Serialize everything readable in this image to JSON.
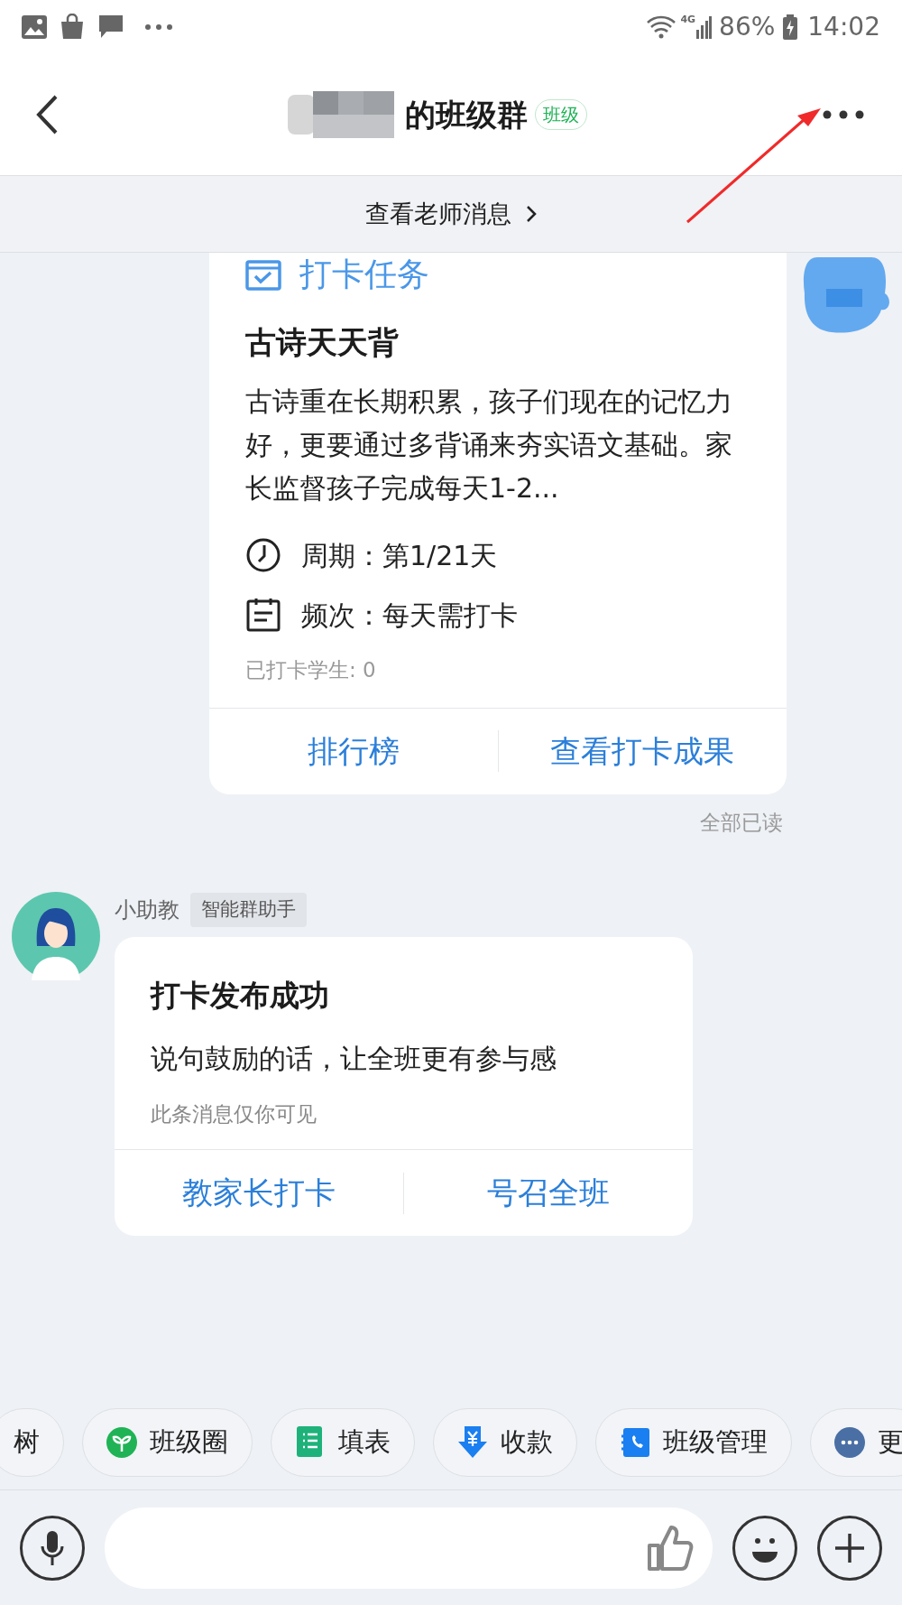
{
  "status_bar": {
    "network": "4G",
    "battery": "86%",
    "time": "14:02"
  },
  "header": {
    "title": "的班级群",
    "tag": "班级"
  },
  "notice": "查看老师消息",
  "messages": [
    {
      "kind": "task_card",
      "card_label": "打卡任务",
      "title": "古诗天天背",
      "description": "古诗重在长期积累，孩子们现在的记忆力好，更要通过多背诵来夯实语文基础。家长监督孩子完成每天1-2...",
      "period": "周期：第1/21天",
      "frequency": "频次：每天需打卡",
      "checked_in": "已打卡学生: 0",
      "actions": [
        "排行榜",
        "查看打卡成果"
      ],
      "read_status": "全部已读"
    },
    {
      "kind": "assistant_card",
      "sender": "小助教",
      "sender_tag": "智能群助手",
      "title": "打卡发布成功",
      "text": "说句鼓励的话，让全班更有参与感",
      "hint": "此条消息仅你可见",
      "actions": [
        "教家长打卡",
        "号召全班"
      ]
    }
  ],
  "shortcuts": [
    {
      "label": "树"
    },
    {
      "label": "班级圈"
    },
    {
      "label": "填表"
    },
    {
      "label": "收款"
    },
    {
      "label": "班级管理"
    },
    {
      "label": "更"
    }
  ]
}
